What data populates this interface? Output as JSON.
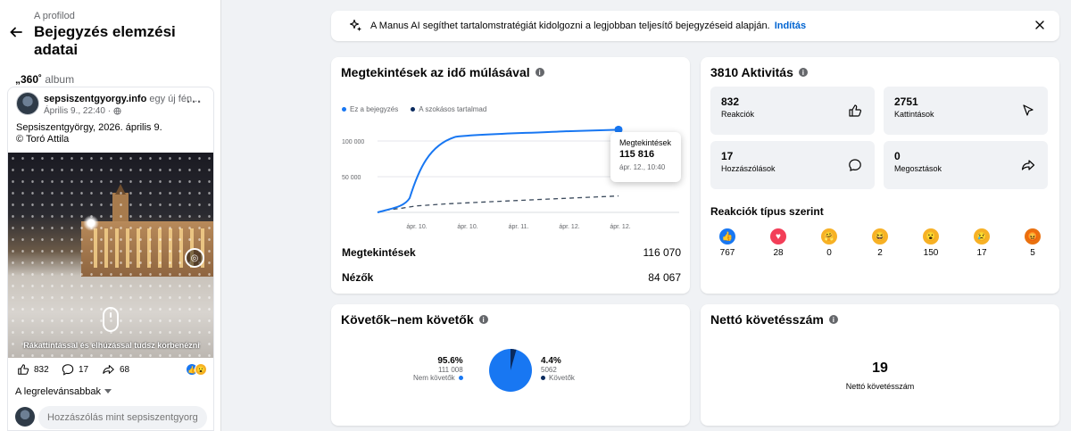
{
  "left": {
    "back_link": "A profilod",
    "title": "Bejegyzés elemzési adatai",
    "album_prefix": "„360˚",
    "album_label": "album",
    "author": "sepsiszentgyorgy.info",
    "author_suffix": " egy új fén...",
    "post_date": "Április 9., 22:40 ·",
    "caption_line1": "Sepsiszentgyörgy, 2026. április 9.",
    "caption_line2": "© Toró Attila",
    "pano_hint": "Rákattintással és elhúzással tudsz körbenézni",
    "likes": "832",
    "comments": "17",
    "shares": "68",
    "sort_label": "A legrelevánsabbak",
    "comment_placeholder": "Hozzászólás mint sepsiszentgyorgy...."
  },
  "banner": {
    "text": "A Manus AI segíthet tartalomstratégiát kidolgozni a legjobban teljesítő bejegyzéseid alapján.",
    "link": "Indítás"
  },
  "views": {
    "title": "Megtekintések az idő múlásával",
    "legend_this": "Ez a bejegyzés",
    "legend_usual": "A szokásos tartalmad",
    "tooltip_title": "Megtekintések",
    "tooltip_value": "115 816",
    "tooltip_date": "ápr. 12., 10:40",
    "stat1_label": "Megtekintések",
    "stat1_value": "116 070",
    "stat2_label": "Nézők",
    "stat2_value": "84 067",
    "colors": {
      "this": "#1877f2",
      "usual": "#3b4a5c"
    }
  },
  "chart_data": {
    "type": "line",
    "x": [
      "ápr. 10.",
      "ápr. 10.",
      "ápr. 11.",
      "ápr. 12.",
      "ápr. 12."
    ],
    "yticks": [
      "100 000",
      "50 000"
    ],
    "ylim": [
      0,
      130000
    ],
    "series": [
      {
        "name": "Ez a bejegyzés",
        "values": [
          0,
          8000,
          25000,
          100000,
          110000,
          113000,
          115000,
          115816
        ]
      },
      {
        "name": "A szokásos tartalmad",
        "values": [
          0,
          3000,
          6000,
          9000,
          12000,
          15000,
          19000,
          23000
        ]
      }
    ]
  },
  "activity": {
    "title": "3810 Aktivitás",
    "boxes": [
      {
        "value": "832",
        "label": "Reakciók"
      },
      {
        "value": "2751",
        "label": "Kattintások"
      },
      {
        "value": "17",
        "label": "Hozzászólások"
      },
      {
        "value": "0",
        "label": "Megosztások"
      }
    ],
    "reactions_title": "Reakciók típus szerint",
    "reactions": [
      {
        "name": "like",
        "count": "767",
        "color": "#1877f2"
      },
      {
        "name": "love",
        "count": "28",
        "color": "#f33e58"
      },
      {
        "name": "care",
        "count": "0",
        "color": "#f7b125"
      },
      {
        "name": "haha",
        "count": "2",
        "color": "#f7b125"
      },
      {
        "name": "wow",
        "count": "150",
        "color": "#f7b125"
      },
      {
        "name": "sad",
        "count": "17",
        "color": "#f7b125"
      },
      {
        "name": "angry",
        "count": "5",
        "color": "#e9710f"
      }
    ]
  },
  "followers": {
    "title": "Követők–nem követők",
    "non_pct": "95.6%",
    "non_count": "111 008",
    "non_label": "Nem követők",
    "fol_pct": "4.4%",
    "fol_count": "5062",
    "fol_label": "Követők",
    "non_fraction": 0.956,
    "colors": {
      "non": "#1877f2",
      "fol": "#0a2a5e"
    }
  },
  "net": {
    "title": "Nettó követésszám",
    "value": "19",
    "label": "Nettó követésszám"
  }
}
